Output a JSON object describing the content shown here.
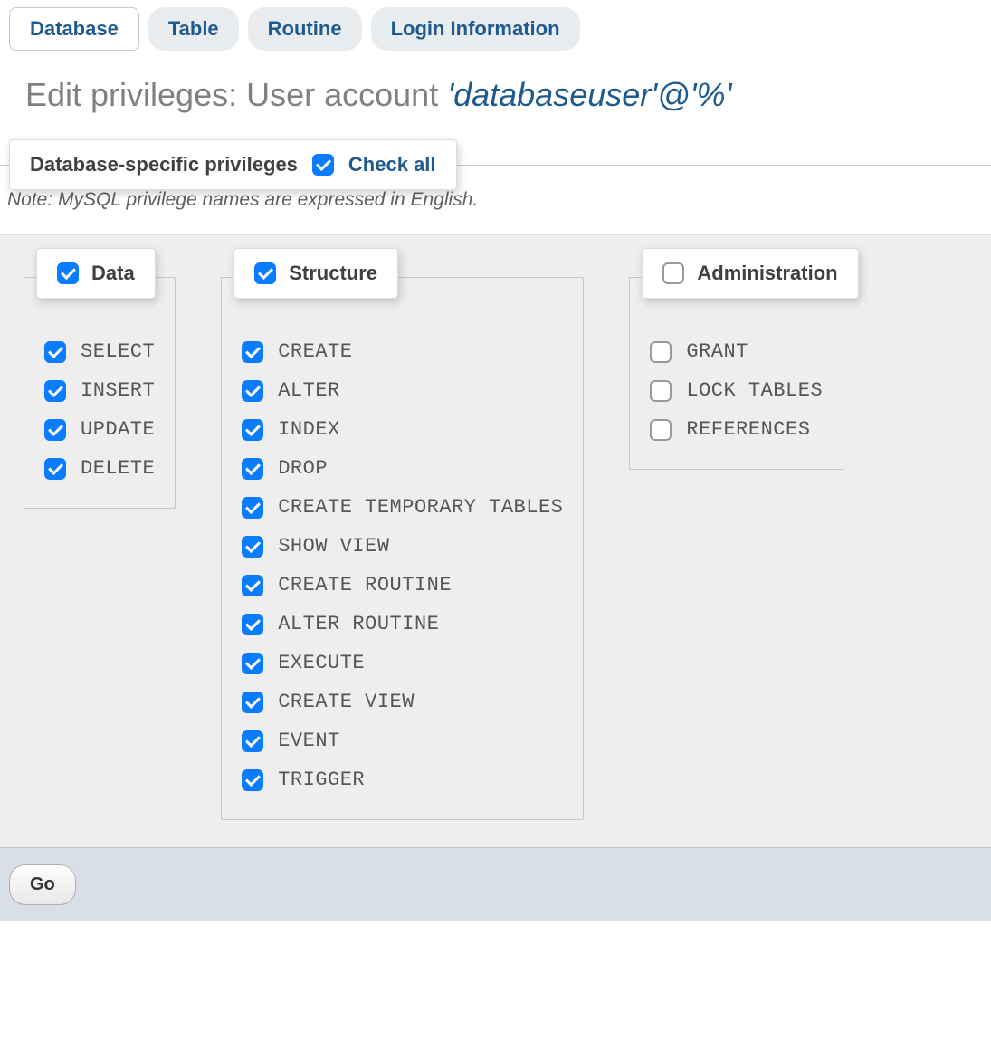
{
  "tabs": [
    {
      "label": "Database",
      "active": true
    },
    {
      "label": "Table",
      "active": false
    },
    {
      "label": "Routine",
      "active": false
    },
    {
      "label": "Login Information",
      "active": false
    }
  ],
  "title_prefix": "Edit privileges: User account ",
  "account": "'databaseuser'@'%'",
  "card": {
    "title": "Database-specific privileges",
    "check_all_label": "Check all",
    "check_all_checked": true
  },
  "note": "Note: MySQL privilege names are expressed in English.",
  "groups": [
    {
      "name": "Data",
      "checked": true,
      "items": [
        {
          "label": "SELECT",
          "checked": true
        },
        {
          "label": "INSERT",
          "checked": true
        },
        {
          "label": "UPDATE",
          "checked": true
        },
        {
          "label": "DELETE",
          "checked": true
        }
      ]
    },
    {
      "name": "Structure",
      "checked": true,
      "items": [
        {
          "label": "CREATE",
          "checked": true
        },
        {
          "label": "ALTER",
          "checked": true
        },
        {
          "label": "INDEX",
          "checked": true
        },
        {
          "label": "DROP",
          "checked": true
        },
        {
          "label": "CREATE TEMPORARY TABLES",
          "checked": true
        },
        {
          "label": "SHOW VIEW",
          "checked": true
        },
        {
          "label": "CREATE ROUTINE",
          "checked": true
        },
        {
          "label": "ALTER ROUTINE",
          "checked": true
        },
        {
          "label": "EXECUTE",
          "checked": true
        },
        {
          "label": "CREATE VIEW",
          "checked": true
        },
        {
          "label": "EVENT",
          "checked": true
        },
        {
          "label": "TRIGGER",
          "checked": true
        }
      ]
    },
    {
      "name": "Administration",
      "checked": false,
      "items": [
        {
          "label": "GRANT",
          "checked": false
        },
        {
          "label": "LOCK TABLES",
          "checked": false
        },
        {
          "label": "REFERENCES",
          "checked": false
        }
      ]
    }
  ],
  "go_label": "Go"
}
